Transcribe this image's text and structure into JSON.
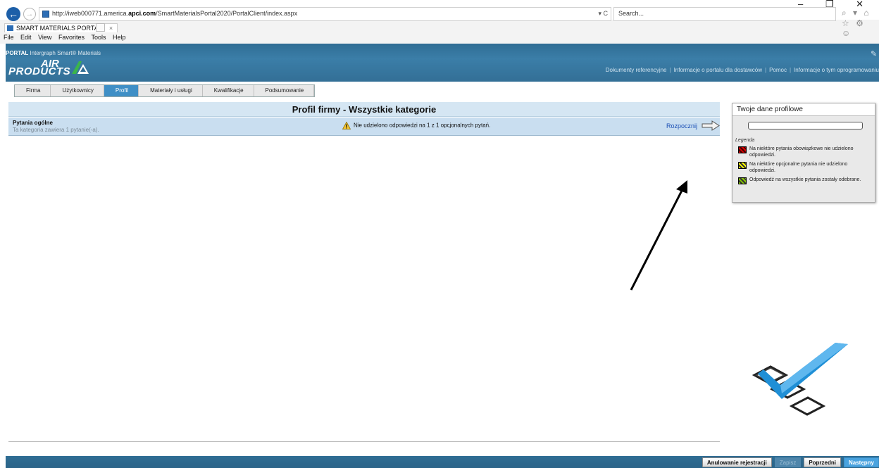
{
  "browser": {
    "url_prefix": "http://iweb000771.america.",
    "url_domain": "apci.com",
    "url_path": "/SmartMaterialsPortal2020/PortalClient/index.aspx",
    "address_tools": "▾ C",
    "search_placeholder": "Search...",
    "right_icons": "⌕ ▾  ⌂ ☆ ⚙ ☺",
    "window_controls": "– ❐ ✕",
    "tab_title": "SMART MATERIALS PORTAL",
    "tab_close": "×",
    "menu": [
      "File",
      "Edit",
      "View",
      "Favorites",
      "Tools",
      "Help"
    ]
  },
  "header": {
    "portal_label": "PORTAL",
    "portal_product": "Intergraph Smart® Materials",
    "logo_line1": "AIR",
    "logo_line2": "PRODUCTS",
    "links": [
      "Dokumenty referencyjne",
      "Informacje o portalu dla dostawców",
      "Pomoc",
      "Informacje o tym oprogramowaniu"
    ],
    "link_separator": "|"
  },
  "wizard": {
    "steps": [
      {
        "label": "Firma",
        "active": false
      },
      {
        "label": "Użytkownicy",
        "active": false
      },
      {
        "label": "Profil",
        "active": true
      },
      {
        "label": "Materiały i usługi",
        "active": false
      },
      {
        "label": "Kwalifikacje",
        "active": false
      },
      {
        "label": "Podsumowanie",
        "active": false
      }
    ]
  },
  "main": {
    "title": "Profil firmy - Wszystkie kategorie",
    "category": {
      "name": "Pytania ogólne",
      "subtitle": "Ta kategoria zawiera 1 pytanie(-a).",
      "warning": "Nie udzielono odpowiedzi na 1 z 1 opcjonalnych pytań.",
      "action": "Rozpocznij"
    }
  },
  "profile_panel": {
    "title": "Twoje dane profilowe",
    "legend_label": "Legenda",
    "legend": [
      {
        "text": "Na niektóre pytania obowiązkowe nie udzielono odpowiedzi.",
        "color": "#cc0000"
      },
      {
        "text": "Na niektóre opcjonalne pytania nie udzielono odpowiedzi.",
        "color": "#ffff00"
      },
      {
        "text": "Odpowiedź na wszystkie pytania zostały odebrane.",
        "color": "#88cc00"
      }
    ]
  },
  "footer": {
    "cancel": "Anulowanie rejestracji",
    "save": "Zapisz",
    "previous": "Poprzedni",
    "next": "Następny"
  },
  "colors": {
    "header": "#2f6d94",
    "active_step": "#3f8fc6",
    "link": "#1a4fb5"
  }
}
